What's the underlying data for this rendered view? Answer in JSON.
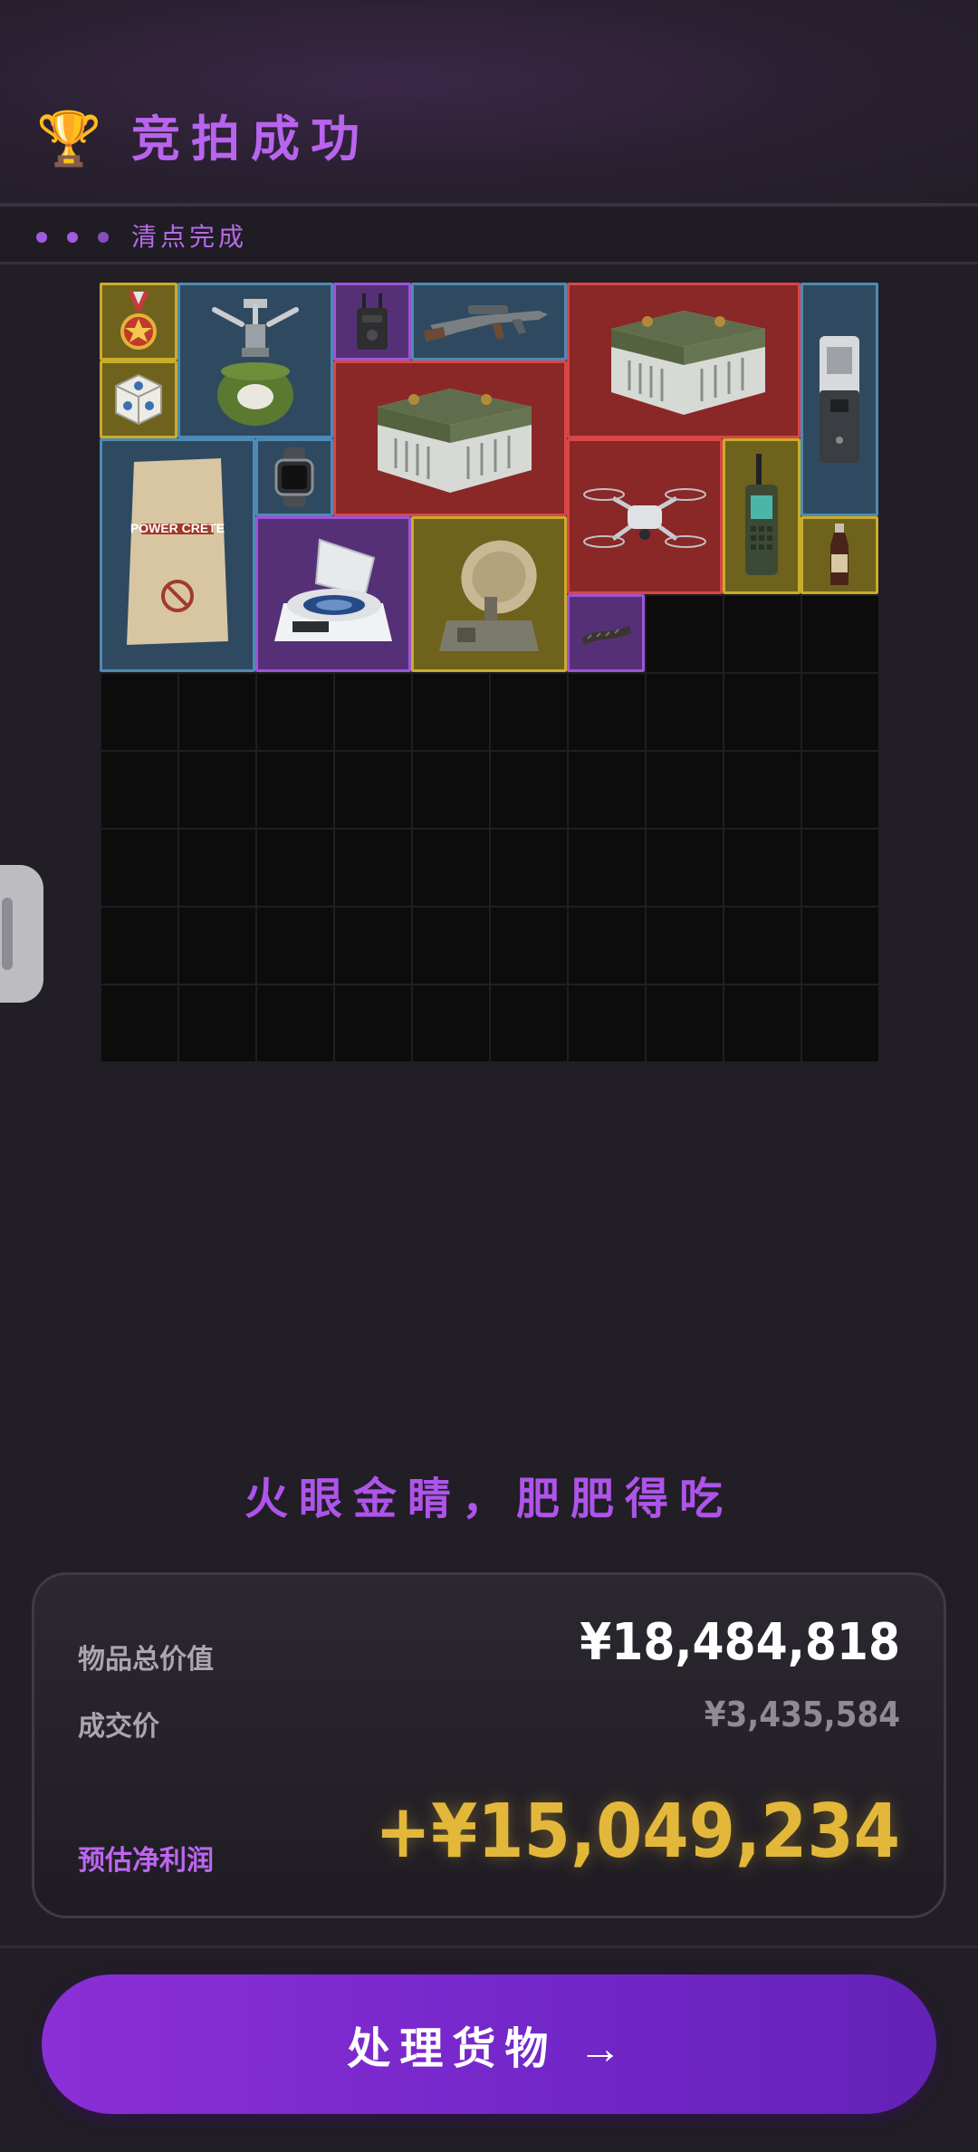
{
  "header": {
    "title": "竞拍成功",
    "trophy_icon": "trophy-icon"
  },
  "status": {
    "text": "清点完成"
  },
  "inventory": {
    "grid_columns": 10,
    "grid_rows": 10,
    "rarity_colors": {
      "yellow": "#c9ac2a",
      "blue": "#4e8ab5",
      "purple": "#9b55d6",
      "red": "#d84646"
    },
    "items": [
      {
        "name": "medal",
        "rarity": "yellow"
      },
      {
        "name": "gas-stove",
        "rarity": "blue"
      },
      {
        "name": "radio-transmitter",
        "rarity": "purple"
      },
      {
        "name": "rifle",
        "rarity": "blue"
      },
      {
        "name": "military-crate-large",
        "rarity": "red"
      },
      {
        "name": "terminal-device",
        "rarity": "blue"
      },
      {
        "name": "cube-toy",
        "rarity": "yellow"
      },
      {
        "name": "military-crate",
        "rarity": "red"
      },
      {
        "name": "cement-bag",
        "rarity": "blue",
        "label": "POWER CRETE"
      },
      {
        "name": "smartwatch",
        "rarity": "blue"
      },
      {
        "name": "drone",
        "rarity": "red"
      },
      {
        "name": "walkie-talkie",
        "rarity": "yellow"
      },
      {
        "name": "sauce-bottle",
        "rarity": "yellow"
      },
      {
        "name": "centrifuge",
        "rarity": "purple"
      },
      {
        "name": "radar-dish",
        "rarity": "yellow"
      },
      {
        "name": "rope",
        "rarity": "purple"
      }
    ]
  },
  "slogan": "火眼金睛，肥肥得吃",
  "summary": {
    "total_label": "物品总价值",
    "total_value": "¥18,484,818",
    "deal_label": "成交价",
    "deal_value": "¥3,435,584",
    "profit_label": "预估净利润",
    "profit_value": "+¥15,049,234"
  },
  "cta": {
    "label": "处理货物 →"
  }
}
